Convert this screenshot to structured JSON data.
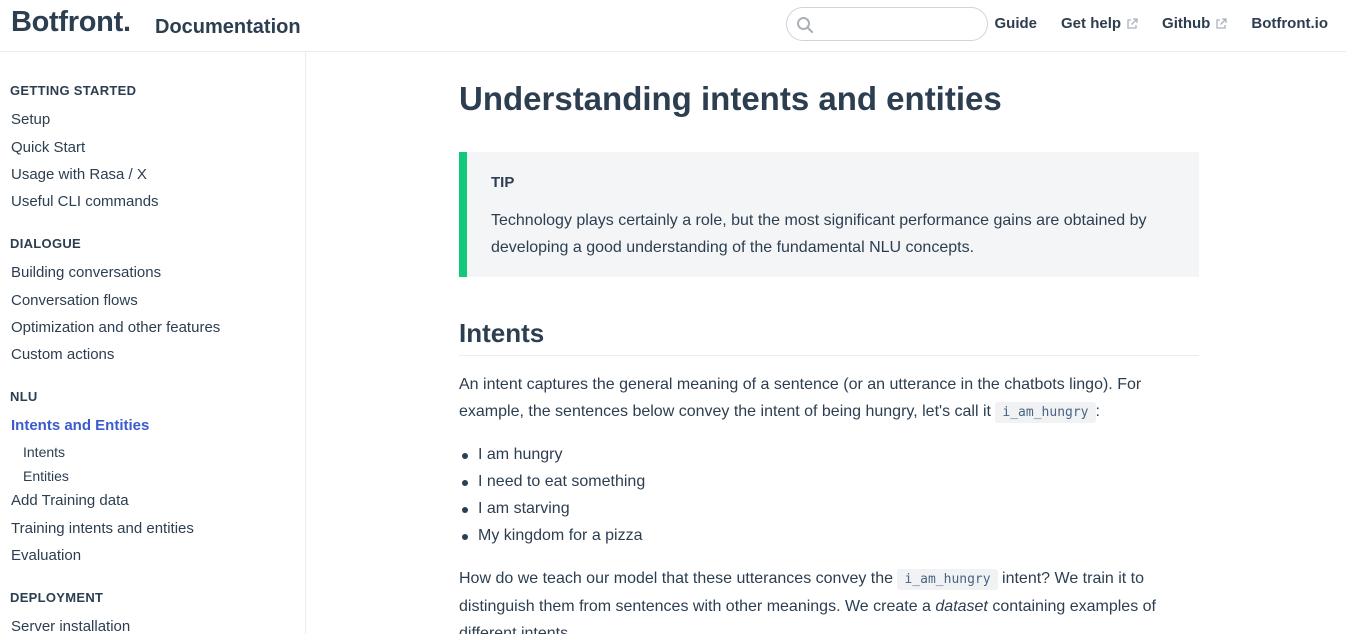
{
  "header": {
    "logo": "Botfront.",
    "site_name": "Documentation",
    "search": {
      "value": "",
      "placeholder": ""
    },
    "nav": [
      {
        "label": "Guide",
        "external": false
      },
      {
        "label": "Get help",
        "external": true
      },
      {
        "label": "Github",
        "external": true
      },
      {
        "label": "Botfront.io",
        "external": false
      }
    ]
  },
  "sidebar": {
    "groups": [
      {
        "title": "GETTING STARTED",
        "items": [
          "Setup",
          "Quick Start",
          "Usage with Rasa / X",
          "Useful CLI commands"
        ]
      },
      {
        "title": "DIALOGUE",
        "items": [
          "Building conversations",
          "Conversation flows",
          "Optimization and other features",
          "Custom actions"
        ]
      },
      {
        "title": "NLU",
        "active_item": "Intents and Entities",
        "sub_items": [
          "Intents",
          "Entities"
        ],
        "items": [
          "Add Training data",
          "Training intents and entities",
          "Evaluation"
        ]
      },
      {
        "title": "DEPLOYMENT",
        "items": [
          "Server installation"
        ]
      }
    ]
  },
  "main": {
    "title": "Understanding intents and entities",
    "tip": {
      "title": "TIP",
      "text": "Technology plays certainly a role, but the most significant performance gains are obtained by developing a good understanding of the fundamental NLU concepts."
    },
    "section_title": "Intents",
    "intro": {
      "before": "An intent captures the general meaning of a sentence (or an utterance in the chatbots lingo). For example, the sentences below convey the intent of being hungry, let's call it ",
      "code": "i_am_hungry",
      "after": ":"
    },
    "examples": [
      "I am hungry",
      "I need to eat something",
      "I am starving",
      "My kingdom for a pizza"
    ],
    "training": {
      "before": "How do we teach our model that these utterances convey the ",
      "code": "i_am_hungry",
      "middle": " intent? We train it to distinguish them from sentences with other meanings. We create a ",
      "emphasis": "dataset",
      "after": " containing examples of different intents."
    }
  },
  "colors": {
    "accent": "#3a5ccc",
    "tip_border": "#12c97b",
    "text": "#2c3e50"
  }
}
